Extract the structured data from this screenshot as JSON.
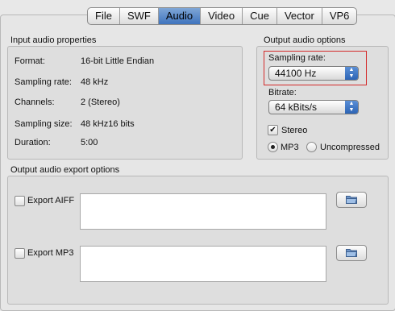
{
  "tabs": [
    "File",
    "SWF",
    "Audio",
    "Video",
    "Cue",
    "Vector",
    "VP6"
  ],
  "active_tab": "Audio",
  "input_props": {
    "title": "Input audio properties",
    "rows": [
      {
        "label": "Format:",
        "value": "16-bit Little Endian"
      },
      {
        "label": "Sampling rate:",
        "value": "48 kHz"
      },
      {
        "label": "Channels:",
        "value": "2 (Stereo)"
      },
      {
        "label": "Sampling size:",
        "value": "48 kHz16 bits"
      },
      {
        "label": "Duration:",
        "value": "5:00"
      }
    ]
  },
  "output_opts": {
    "title": "Output audio options",
    "sampling_rate_label": "Sampling rate:",
    "sampling_rate_value": "44100 Hz",
    "bitrate_label": "Bitrate:",
    "bitrate_value": "64 kBits/s",
    "stereo_label": "Stereo",
    "stereo_checked": true,
    "mp3_label": "MP3",
    "uncompressed_label": "Uncompressed",
    "selected_format": "MP3"
  },
  "export": {
    "title": "Output audio export options",
    "aiff_label": "Export AIFF",
    "mp3_label": "Export MP3"
  },
  "colors": {
    "highlight": "#d42a2a",
    "tab_active": "#5a8fd6"
  }
}
